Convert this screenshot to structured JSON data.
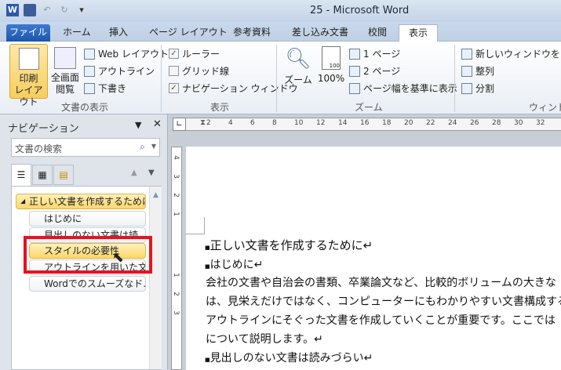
{
  "window": {
    "title": "25  -  Microsoft Word"
  },
  "qat": {
    "save": "save-icon",
    "undo": "undo-icon",
    "redo": "redo-icon"
  },
  "tabs": [
    "ファイル",
    "ホーム",
    "挿入",
    "ページ レイアウト",
    "参考資料",
    "差し込み文書",
    "校閲",
    "表示"
  ],
  "ribbon": {
    "doc_view": {
      "label": "文書の表示",
      "print_layout": "印刷\nレイアウト",
      "print_layout_l1": "印刷",
      "print_layout_l2": "レイアウト",
      "full_screen_l1": "全画面",
      "full_screen_l2": "閲覧",
      "web": "Web レイアウト",
      "outline": "アウトライン",
      "draft": "下書き"
    },
    "show": {
      "label": "表示",
      "ruler": "ルーラー",
      "ruler_checked": true,
      "grid": "グリッド線",
      "grid_checked": false,
      "nav": "ナビゲーション ウィンドウ",
      "nav_checked": true
    },
    "zoom": {
      "label": "ズーム",
      "zoom": "ズーム",
      "hundred": "100%",
      "icon_text": "100",
      "one_page": "1 ページ",
      "two_pages": "2 ページ",
      "page_width": "ページ幅を基準に表示"
    },
    "window": {
      "label": "ウィンドウ",
      "new_window": "新しいウィンドウを開く",
      "arrange": "整列",
      "split": "分割"
    }
  },
  "nav": {
    "title": "ナビゲーション",
    "search_placeholder": "文書の検索",
    "items": [
      {
        "label": "正しい文書を作成するために",
        "level": 1
      },
      {
        "label": "はじめに",
        "level": 2
      },
      {
        "label": "見出しのない文書は読",
        "level": 2
      },
      {
        "label": "スタイルの必要性",
        "level": 2
      },
      {
        "label": "アウトラインを用いた文...",
        "level": 2
      },
      {
        "label": "Wordでのスムーズなド...",
        "level": 2
      }
    ]
  },
  "ruler": {
    "h_ticks": [
      "2",
      "4",
      "6",
      "8",
      "10",
      "12",
      "14",
      "16",
      "18",
      "20",
      "22",
      "24",
      "26",
      "28",
      "30",
      "32"
    ],
    "v_ticks": [
      "4",
      "3",
      "2",
      "1",
      "1",
      "2",
      "3"
    ]
  },
  "document": {
    "lines": [
      {
        "text": "正しい文書を作成するために↵",
        "type": "heading1"
      },
      {
        "text": "はじめに↵",
        "type": "heading2"
      },
      {
        "text": "会社の文書や自治会の書類、卒業論文など、比較的ボリュームの大きな",
        "type": "body"
      },
      {
        "text": "は、見栄えだけではなく、コンピューターにもわかりやすい文書構成する",
        "type": "body"
      },
      {
        "text": "アウトラインにそぐった文書を作成していくことが重要です。ここでは",
        "type": "body"
      },
      {
        "text": "について説明します。↵",
        "type": "body"
      },
      {
        "text": "見出しのない文書は読みづらい↵",
        "type": "heading2"
      }
    ]
  },
  "colors": {
    "highlight": "#e5141e",
    "selected": "#fbd66a",
    "file_tab": "#1d56ac"
  }
}
